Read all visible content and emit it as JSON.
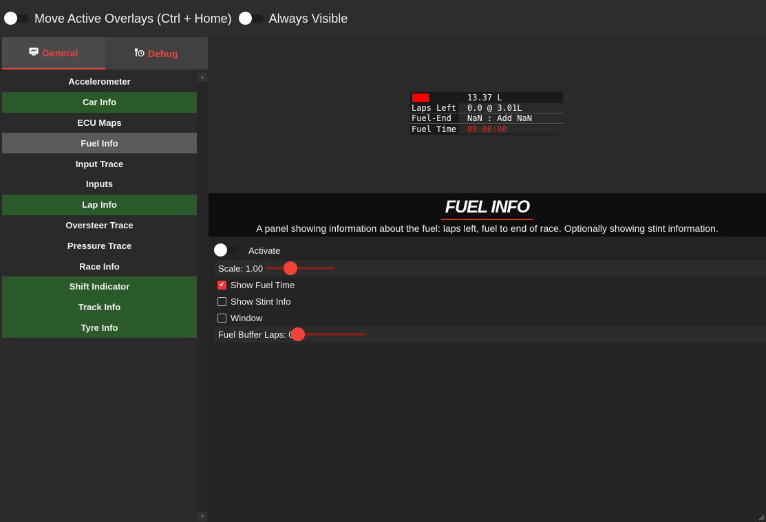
{
  "topbar": {
    "move_label": "Move Active Overlays (Ctrl + Home)",
    "visible_label": "Always Visible"
  },
  "tabs": {
    "general": "General",
    "debug": "Debug"
  },
  "overlay_list": [
    {
      "label": "Accelerometer",
      "state": "inactive"
    },
    {
      "label": "Car Info",
      "state": "active"
    },
    {
      "label": "ECU Maps",
      "state": "inactive"
    },
    {
      "label": "Fuel Info",
      "state": "selected"
    },
    {
      "label": "Input Trace",
      "state": "inactive"
    },
    {
      "label": "Inputs",
      "state": "inactive"
    },
    {
      "label": "Lap Info",
      "state": "active"
    },
    {
      "label": "Oversteer Trace",
      "state": "inactive"
    },
    {
      "label": "Pressure Trace",
      "state": "inactive"
    },
    {
      "label": "Race Info",
      "state": "inactive"
    },
    {
      "label": "Shift Indicator",
      "state": "active"
    },
    {
      "label": "Track Info",
      "state": "active"
    },
    {
      "label": "Tyre Info",
      "state": "active"
    }
  ],
  "preview": {
    "fuel_amount": "13.37 L",
    "laps_left_label": "Laps Left",
    "laps_left_value": "0.0 @ 3.01L",
    "fuel_end_label": "Fuel-End",
    "fuel_end_value": "NaN : Add NaN",
    "fuel_time_label": "Fuel Time",
    "fuel_time_value": "00:00:00"
  },
  "banner": {
    "title": "FUEL INFO",
    "description": "A panel showing information about the fuel: laps left, fuel to end of race. Optionally showing stint information."
  },
  "settings": {
    "activate_label": "Activate",
    "scale_label": "Scale: 1.00",
    "scale_value": 1.0,
    "show_fuel_time_label": "Show Fuel Time",
    "show_fuel_time": true,
    "show_stint_info_label": "Show Stint Info",
    "show_stint_info": false,
    "window_label": "Window",
    "window": false,
    "fuel_buffer_label": "Fuel Buffer Laps: 0",
    "fuel_buffer_value": 0
  },
  "colors": {
    "accent": "#e8463c",
    "active_green": "#2a5a2a",
    "selected_gray": "#5a5a5a"
  }
}
